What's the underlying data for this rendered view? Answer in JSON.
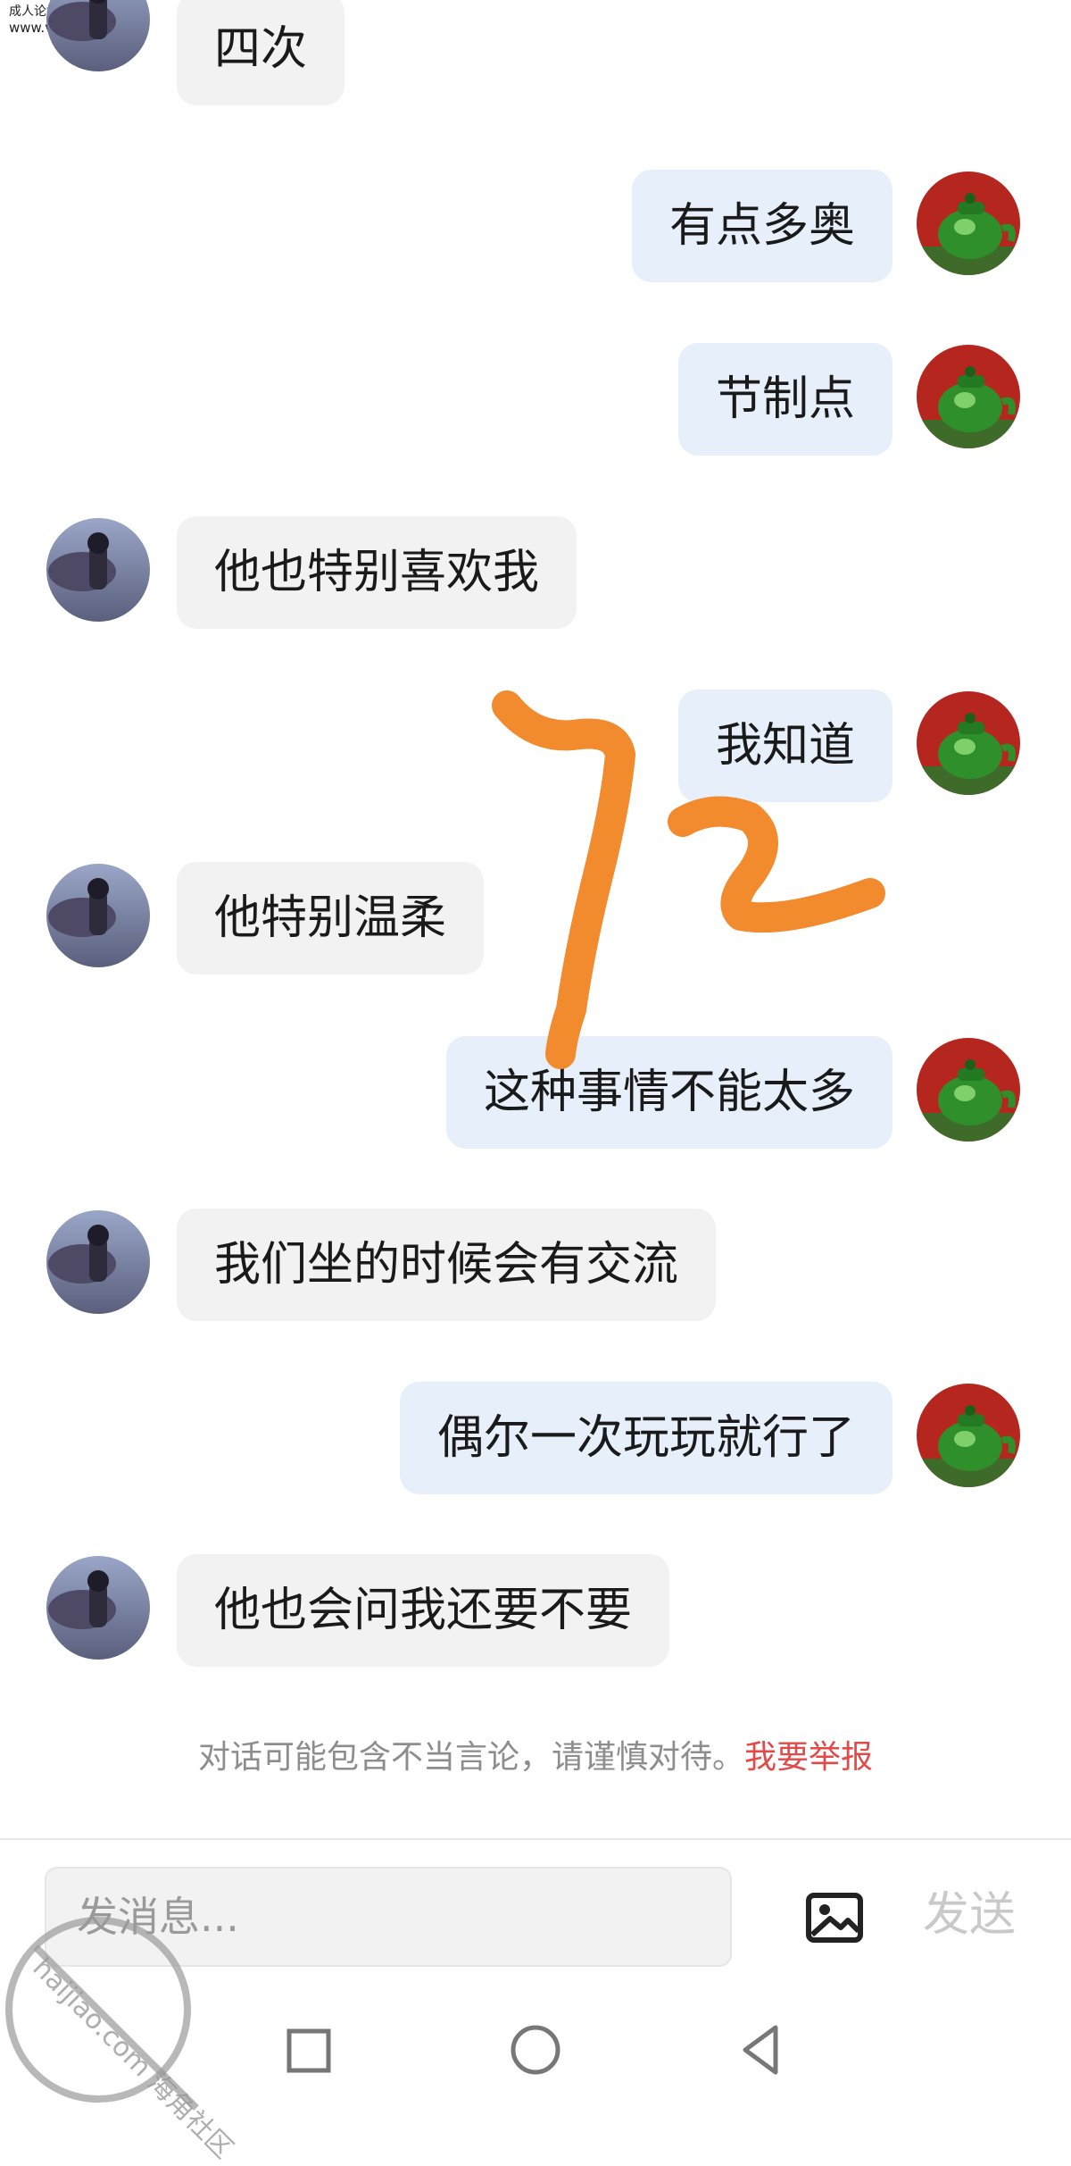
{
  "watermark_top": {
    "line1": "成人论坛",
    "line2": "www.v43d.com"
  },
  "messages": [
    {
      "side": "left",
      "text": "四次"
    },
    {
      "side": "right",
      "text": "有点多奥"
    },
    {
      "side": "right",
      "text": "节制点"
    },
    {
      "side": "left",
      "text": "他也特别喜欢我"
    },
    {
      "side": "right",
      "text": "我知道"
    },
    {
      "side": "left",
      "text": "他特别温柔"
    },
    {
      "side": "right",
      "text": "这种事情不能太多"
    },
    {
      "side": "left",
      "text": "我们坐的时候会有交流"
    },
    {
      "side": "right",
      "text": "偶尔一次玩玩就行了"
    },
    {
      "side": "left",
      "text": "他也会问我还要不要"
    }
  ],
  "notice": {
    "text": "对话可能包含不当言论，请谨慎对待。",
    "report_link": "我要举报"
  },
  "input": {
    "placeholder": "发消息..."
  },
  "send_label": "发送",
  "icons": {
    "image": "image-icon",
    "nav_recent": "square-icon",
    "nav_home": "circle-icon",
    "nav_back": "back-triangle-icon"
  },
  "overlay_annotation": "72",
  "watermark_bottom": "haijiao.com 海角社区",
  "colors": {
    "left_bubble": "#f2f2f2",
    "right_bubble": "#e6effa",
    "report_link": "#e24a4a",
    "annotation": "#f28a2e",
    "send_disabled": "#c9c9c9"
  }
}
